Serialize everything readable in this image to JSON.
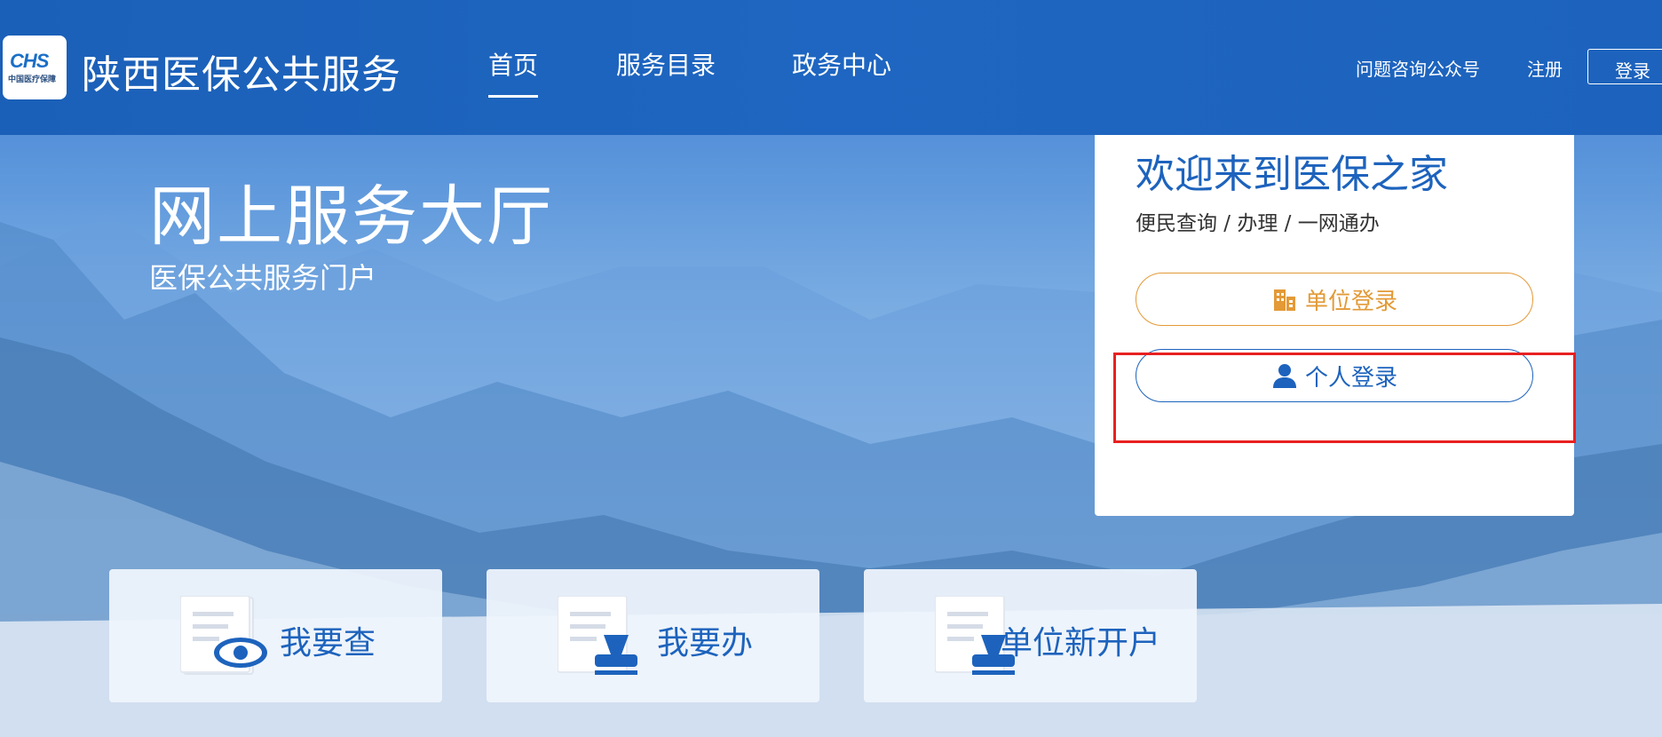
{
  "header": {
    "logo_text": "CHS",
    "logo_subtext": "中国医疗保障",
    "site_title": "陕西医保公共服务",
    "nav": [
      {
        "label": "首页",
        "active": true
      },
      {
        "label": "服务目录",
        "active": false
      },
      {
        "label": "政务中心",
        "active": false
      }
    ],
    "links": {
      "wechat": "问题咨询公众号",
      "register": "注册",
      "login": "登录"
    }
  },
  "hero": {
    "title": "网上服务大厅",
    "subtitle": "医保公共服务门户"
  },
  "login_panel": {
    "title": "欢迎来到医保之家",
    "subtitle": "便民查询 / 办理 / 一网通办",
    "unit_login": "单位登录",
    "personal_login": "个人登录"
  },
  "cards": [
    {
      "label": "我要查",
      "icon": "document-eye-icon"
    },
    {
      "label": "我要办",
      "icon": "document-stamp-icon"
    },
    {
      "label": "单位新开户",
      "icon": "document-stamp-icon"
    }
  ],
  "colors": {
    "brand_blue": "#1d63bd",
    "unit_orange": "#e39a37",
    "highlight_red": "#e82020"
  }
}
